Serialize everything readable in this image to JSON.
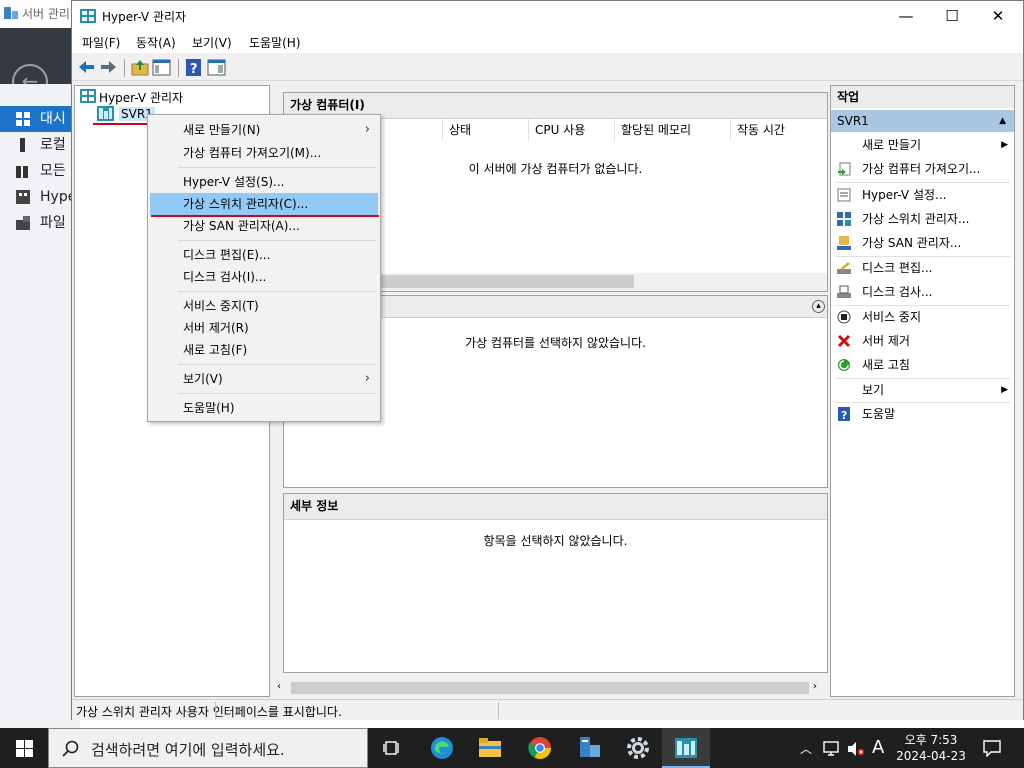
{
  "background_window": {
    "title": "서버 관리",
    "nav_items": [
      "대시",
      "로컬",
      "모든",
      "Hype",
      "파일"
    ]
  },
  "window": {
    "title": "Hyper-V 관리자",
    "minimize": "—",
    "maximize": "☐",
    "close": "✕"
  },
  "menu": [
    "파일(F)",
    "동작(A)",
    "보기(V)",
    "도움말(H)"
  ],
  "tree": {
    "root": "Hyper-V 관리자",
    "server": "SVR1"
  },
  "vm_panel": {
    "title": "가상 컴퓨터(I)",
    "columns": [
      "상태",
      "CPU 사용",
      "할당된 메모리",
      "작동 시간"
    ],
    "empty_message": "이 서버에 가상 컴퓨터가 없습니다."
  },
  "checkpoint_panel": {
    "empty_message": "가상 컴퓨터를 선택하지 않았습니다."
  },
  "details_panel": {
    "title": "세부 정보",
    "empty_message": "항목을 선택하지 않았습니다."
  },
  "actions": {
    "title": "작업",
    "group": "SVR1",
    "items": [
      {
        "label": "새로 만들기",
        "icon": "blank",
        "submenu": true
      },
      {
        "label": "가상 컴퓨터 가져오기...",
        "icon": "import-icon"
      },
      {
        "label": "Hyper-V 설정...",
        "icon": "settings-icon"
      },
      {
        "label": "가상 스위치 관리자...",
        "icon": "switch-icon"
      },
      {
        "label": "가상 SAN 관리자...",
        "icon": "san-icon"
      },
      {
        "label": "디스크 편집...",
        "icon": "edit-disk-icon"
      },
      {
        "label": "디스크 검사...",
        "icon": "inspect-disk-icon"
      },
      {
        "label": "서비스 중지",
        "icon": "stop-icon"
      },
      {
        "label": "서버 제거",
        "icon": "remove-icon"
      },
      {
        "label": "새로 고침",
        "icon": "refresh-icon"
      },
      {
        "label": "보기",
        "icon": "blank",
        "submenu": true
      },
      {
        "label": "도움말",
        "icon": "help-icon"
      }
    ]
  },
  "context_menu": {
    "items": [
      "새로 만들기(N)",
      "가상 컴퓨터 가져오기(M)...",
      "Hyper-V 설정(S)...",
      "가상 스위치 관리자(C)...",
      "가상 SAN 관리자(A)...",
      "디스크 편집(E)...",
      "디스크 검사(I)...",
      "서비스 중지(T)",
      "서버 제거(R)",
      "새로 고침(F)",
      "보기(V)",
      "도움말(H)"
    ],
    "submenu_arrow": "›"
  },
  "status_bar": "가상 스위치 관리자 사용자 인터페이스를 표시합니다.",
  "taskbar": {
    "search_placeholder": "검색하려면 여기에 입력하세요.",
    "time": "오후 7:53",
    "date": "2024-04-23",
    "ime": "A"
  },
  "colors": {
    "selection": "#91c9f7",
    "annotation_red": "#d0021b",
    "actions_group": "#a9c6e2",
    "taskbar": "#1f1f1f"
  }
}
